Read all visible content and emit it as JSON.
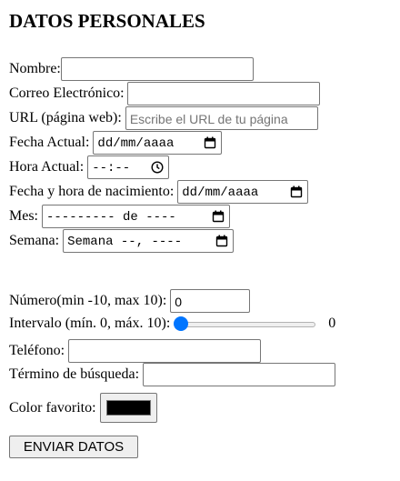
{
  "form": {
    "title": "DATOS PERSONALES",
    "nombre_label": "Nombre:",
    "correo_label": "Correo Electrónico:",
    "url_label": "URL (página web):",
    "url_placeholder": "Escribe el URL de tu página",
    "fecha_label": "Fecha Actual:",
    "fecha_value": "dd/mm/aaaa",
    "hora_label": "Hora Actual:",
    "hora_value": "--:--",
    "nacimiento_label": "Fecha y hora de nacimiento:",
    "nacimiento_value": "dd/mm/aaaa",
    "mes_label": "Mes:",
    "mes_value": "--------- de ----",
    "semana_label": "Semana:",
    "semana_value": "Semana --, ----",
    "numero_label": "Número(min -10, max 10):",
    "numero_value": "0",
    "intervalo_label": "Intervalo (mín. 0, máx. 10):",
    "intervalo_value": "0",
    "intervalo_level": 0,
    "telefono_label": "Teléfono:",
    "busqueda_label": "Término de búsqueda:",
    "color_label": "Color favorito:",
    "color_value": "#000000",
    "submit_label": "ENVIAR DATOS"
  },
  "colors": {
    "slider_thumb": "#0075ff",
    "border": "#767676",
    "button_bg": "#efefef"
  }
}
